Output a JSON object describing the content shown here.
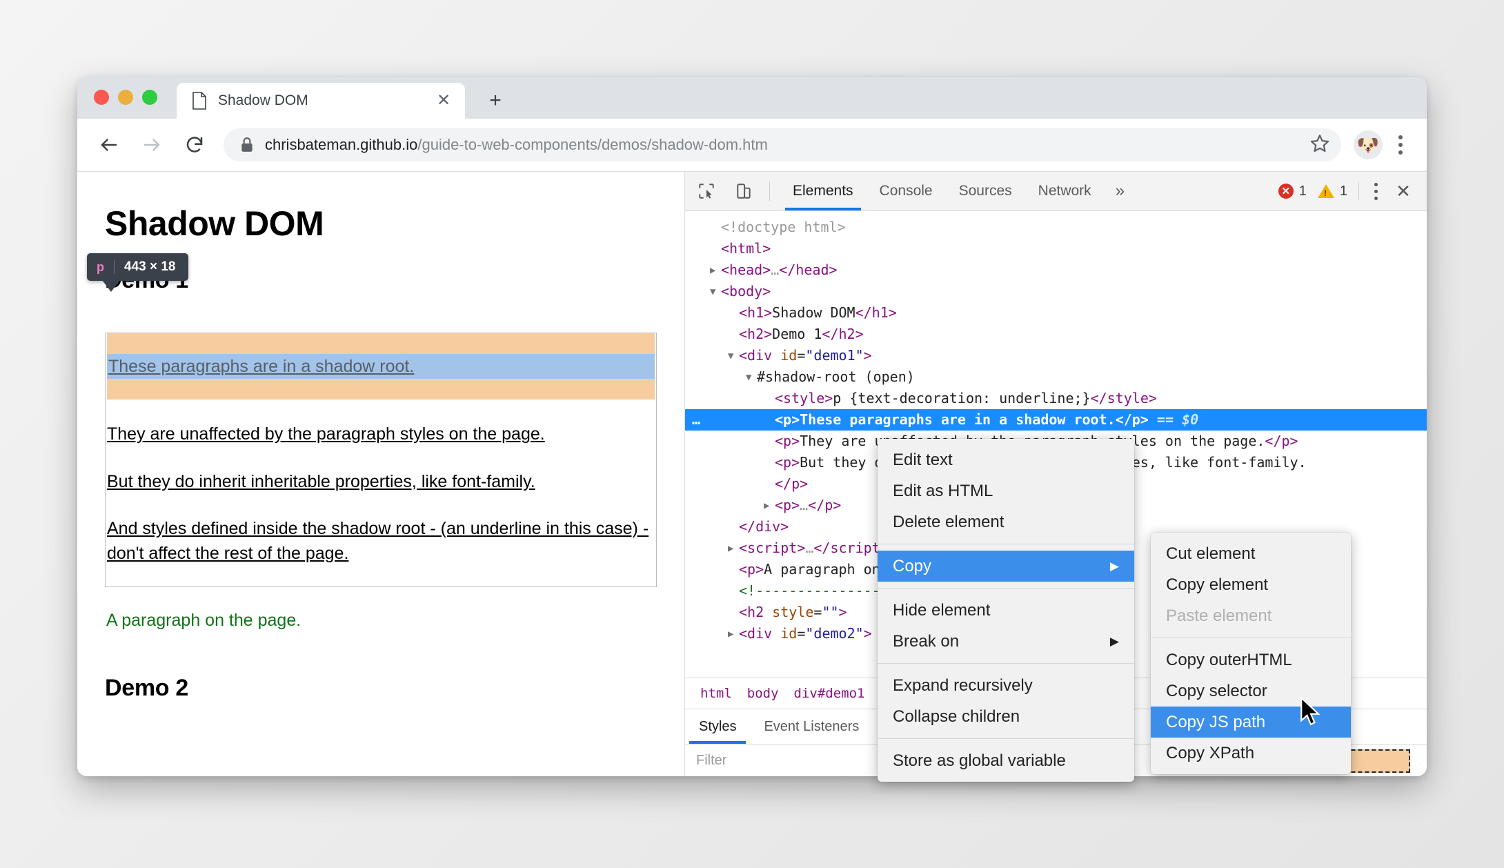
{
  "browser": {
    "tab": {
      "title": "Shadow DOM",
      "favicon_icon": "page-icon",
      "close_icon": "✕"
    },
    "new_tab_label": "+",
    "nav": {
      "back_icon": "←",
      "forward_icon": "→",
      "reload_icon": "⟳"
    },
    "omnibox": {
      "lock_icon": "lock-icon",
      "host": "chrisbateman.github.io",
      "path": "/guide-to-web-components/demos/shadow-dom.htm",
      "star_icon": "☆"
    },
    "avatar_icon": "🐶",
    "menu_icon": "kebab-icon"
  },
  "page": {
    "h1": "Shadow DOM",
    "h2_demo1": "Demo 1",
    "h2_demo2": "Demo 2",
    "inspect_tooltip": {
      "tag": "p",
      "dimensions": "443 × 18"
    },
    "shadow_paragraphs": [
      "These paragraphs are in a shadow root.",
      "They are unaffected by the paragraph styles on the page.",
      "But they do inherit inheritable properties, like font-family.",
      "And styles defined inside the shadow root - (an underline in this case) - don't affect the rest of the page."
    ],
    "page_paragraph": "A paragraph on the page."
  },
  "devtools": {
    "toolbar": {
      "inspect_icon": "cursor-select-icon",
      "device_icon": "device-toolbar-icon",
      "tabs": [
        {
          "label": "Elements",
          "active": true
        },
        {
          "label": "Console",
          "active": false
        },
        {
          "label": "Sources",
          "active": false
        },
        {
          "label": "Network",
          "active": false
        }
      ],
      "more_tabs_icon": "»",
      "error_count": "1",
      "warning_count": "1",
      "kebab_icon": "kebab-icon",
      "close_icon": "✕"
    },
    "dom_lines": [
      {
        "indent": 0,
        "arrow": "",
        "html": "<span class=\"grey\">&lt;!doctype html&gt;</span>"
      },
      {
        "indent": 0,
        "arrow": "",
        "html": "<span class=\"tag\">&lt;html&gt;</span>"
      },
      {
        "indent": 0,
        "arrow": "▶",
        "html": "<span class=\"tag\">&lt;head&gt;</span><span class=\"grey\">…</span><span class=\"tag\">&lt;/head&gt;</span>"
      },
      {
        "indent": 0,
        "arrow": "▼",
        "html": "<span class=\"tag\">&lt;body&gt;</span>"
      },
      {
        "indent": 1,
        "arrow": "",
        "html": "<span class=\"tag\">&lt;h1&gt;</span><span class=\"txt\">Shadow DOM</span><span class=\"tag\">&lt;/h1&gt;</span>"
      },
      {
        "indent": 1,
        "arrow": "",
        "html": "<span class=\"tag\">&lt;h2&gt;</span><span class=\"txt\">Demo 1</span><span class=\"tag\">&lt;/h2&gt;</span>"
      },
      {
        "indent": 1,
        "arrow": "▼",
        "html": "<span class=\"tag\">&lt;div</span> <span class=\"attr\">id</span>=<span class=\"val\">\"demo1\"</span><span class=\"tag\">&gt;</span>"
      },
      {
        "indent": 2,
        "arrow": "▼",
        "html": "<span class=\"shadowroot\">#shadow-root (open)</span>"
      },
      {
        "indent": 3,
        "arrow": "",
        "html": "<span class=\"tag\">&lt;style&gt;</span><span class=\"txt\">p {text-decoration: underline;}</span><span class=\"tag\">&lt;/style&gt;</span>"
      },
      {
        "indent": 3,
        "arrow": "",
        "selected": true,
        "html": "<span class=\"tag\">&lt;p&gt;</span><span class=\"txt\">These paragraphs are in a shadow root.</span><span class=\"tag\">&lt;/p&gt;</span> <span class=\"eq\">== $0</span>"
      },
      {
        "indent": 3,
        "arrow": "",
        "html": "<span class=\"tag\">&lt;p&gt;</span><span class=\"txt\">They are unaffected by the paragraph styles on the page.</span><span class=\"tag\">&lt;/p&gt;</span>"
      },
      {
        "indent": 3,
        "arrow": "",
        "html": "<span class=\"tag\">&lt;p&gt;</span><span class=\"txt\">But they do inherit inheritable properties, like font-family.</span>"
      },
      {
        "indent": 3,
        "arrow": "",
        "html": "<span class=\"tag\">&lt;/p&gt;</span>"
      },
      {
        "indent": 3,
        "arrow": "▶",
        "html": "<span class=\"tag\">&lt;p&gt;</span><span class=\"grey\">…</span><span class=\"tag\">&lt;/p&gt;</span>"
      },
      {
        "indent": 1,
        "arrow": "",
        "html": "<span class=\"tag\">&lt;/div&gt;</span>"
      },
      {
        "indent": 1,
        "arrow": "▶",
        "html": "<span class=\"tag\">&lt;script&gt;</span><span class=\"grey\">…</span><span class=\"tag\">&lt;/script&gt;</span>"
      },
      {
        "indent": 1,
        "arrow": "",
        "html": "<span class=\"tag\">&lt;p&gt;</span><span class=\"txt\">A paragraph on the page.</span><span class=\"tag\">&lt;/p&gt;</span>"
      },
      {
        "indent": 1,
        "arrow": "",
        "html": "<span class=\"comment\">&lt;!------------------------&gt;</span>"
      },
      {
        "indent": 1,
        "arrow": "",
        "html": "<span class=\"tag\">&lt;h2</span> <span class=\"attr\">style</span>=<span class=\"val\">\"\"</span><span class=\"tag\">&gt;</span>"
      },
      {
        "indent": 1,
        "arrow": "▶",
        "html": "<span class=\"tag\">&lt;div</span> <span class=\"attr\">id</span>=<span class=\"val\">\"demo2\"</span><span class=\"tag\">&gt;</span>"
      }
    ],
    "breadcrumb": [
      "html",
      "body",
      "div#demo1"
    ],
    "styles_tabs": [
      {
        "label": "Styles",
        "active": true
      },
      {
        "label": "Event Listeners",
        "active": false
      }
    ],
    "filter_placeholder": "Filter"
  },
  "context_menu": {
    "main": [
      {
        "label": "Edit text",
        "type": "item"
      },
      {
        "label": "Edit as HTML",
        "type": "item"
      },
      {
        "label": "Delete element",
        "type": "item"
      },
      {
        "type": "divider"
      },
      {
        "label": "Copy",
        "type": "submenu",
        "selected": true,
        "caret": "▶"
      },
      {
        "type": "divider"
      },
      {
        "label": "Hide element",
        "type": "item"
      },
      {
        "label": "Break on",
        "type": "submenu",
        "caret": "▶"
      },
      {
        "type": "divider"
      },
      {
        "label": "Expand recursively",
        "type": "item"
      },
      {
        "label": "Collapse children",
        "type": "item"
      },
      {
        "type": "divider"
      },
      {
        "label": "Store as global variable",
        "type": "item"
      }
    ],
    "sub": [
      {
        "label": "Cut element",
        "type": "item"
      },
      {
        "label": "Copy element",
        "type": "item"
      },
      {
        "label": "Paste element",
        "type": "item",
        "disabled": true
      },
      {
        "type": "divider"
      },
      {
        "label": "Copy outerHTML",
        "type": "item"
      },
      {
        "label": "Copy selector",
        "type": "item"
      },
      {
        "label": "Copy JS path",
        "type": "item",
        "selected": true
      },
      {
        "label": "Copy XPath",
        "type": "item"
      }
    ]
  },
  "colors": {
    "accent": "#1a73e8",
    "selection": "#1a8cff",
    "menu_selection": "#3b8eea",
    "shadow_highlight": "#a3c4e8",
    "padding_highlight": "#f7cda0",
    "green_text": "#11731a",
    "error": "#d93025",
    "warning": "#f0b400"
  }
}
